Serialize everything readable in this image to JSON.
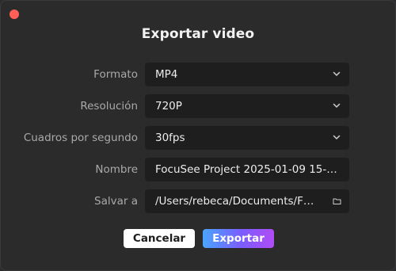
{
  "dialog": {
    "title": "Exportar video",
    "close_color": "#ff5f57"
  },
  "form": {
    "format": {
      "label": "Formato",
      "value": "MP4",
      "icon": "chevron-down-icon"
    },
    "resolution": {
      "label": "Resolución",
      "value": "720P",
      "icon": "chevron-down-icon"
    },
    "fps": {
      "label": "Cuadros por segundo",
      "value": "30fps",
      "icon": "chevron-down-icon"
    },
    "name": {
      "label": "Nombre",
      "value": "FocuSee Project 2025-01-09 15-…"
    },
    "save_to": {
      "label": "Salvar a",
      "value": "/Users/rebeca/Documents/F…",
      "icon": "folder-icon"
    }
  },
  "buttons": {
    "cancel_label": "Cancelar",
    "export_label": "Exportar"
  },
  "colors": {
    "background": "#2b2b2b",
    "field": "#1e1e1e",
    "export_gradient": [
      "#4aa5ff",
      "#7b5cff",
      "#b04cf5"
    ]
  }
}
